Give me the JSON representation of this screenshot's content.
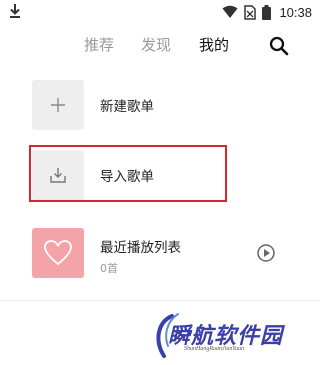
{
  "status_bar": {
    "time": "10:38",
    "icons": [
      "download-icon",
      "wifi-icon",
      "no-sim-icon",
      "battery-icon"
    ]
  },
  "tabs": [
    {
      "label": "推荐",
      "active": false
    },
    {
      "label": "发现",
      "active": false
    },
    {
      "label": "我的",
      "active": true
    }
  ],
  "actions": {
    "search_icon": "search-icon"
  },
  "rows": {
    "new_playlist": {
      "label": "新建歌单",
      "icon": "plus-icon"
    },
    "import_playlist": {
      "label": "导入歌单",
      "icon": "import-icon"
    },
    "recent_playlist": {
      "label": "最近播放列表",
      "count": "0首",
      "icon": "heart-icon"
    }
  },
  "colors": {
    "highlight_border": "#d9262a",
    "recent_thumb": "#f4a3a8",
    "active_tab": "#111111",
    "inactive_tab": "#9a9a9a",
    "watermark": "#3b3fa8"
  },
  "watermark": {
    "title": "瞬航软件园",
    "subtitle": "ShunHangRuanJianYuan"
  }
}
